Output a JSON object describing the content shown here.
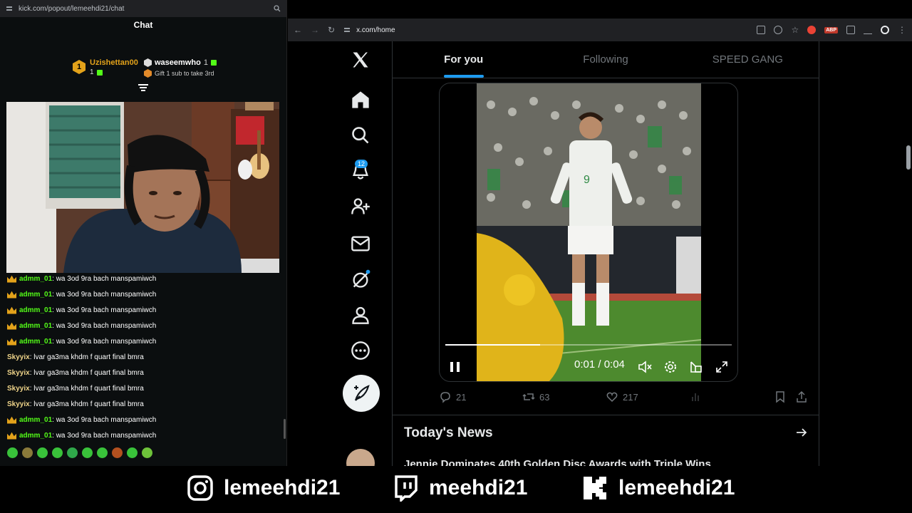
{
  "chat_window": {
    "url": "kick.com/popout/lemeehdi21/chat",
    "title": "Chat",
    "leaderboard": [
      {
        "rank": "1",
        "name": "Uzishettan00",
        "count": "1"
      },
      {
        "name": "waseemwho",
        "count": "1",
        "note": "Gift 1 sub to take 3rd"
      }
    ],
    "messages": [
      {
        "user": "admm_01",
        "text": ": wa 3od 9ra bach manspamiwch",
        "badge": "crown"
      },
      {
        "user": "admm_01",
        "text": ": wa 3od 9ra bach manspamiwch",
        "badge": "crown"
      },
      {
        "user": "admm_01",
        "text": ": wa 3od 9ra bach manspamiwch",
        "badge": "crown"
      },
      {
        "user": "admm_01",
        "text": ": wa 3od 9ra bach manspamiwch",
        "badge": "crown"
      },
      {
        "user": "admm_01",
        "text": ": wa 3od 9ra bach manspamiwch",
        "badge": "crown"
      },
      {
        "user": "Skyyix",
        "text": ": lvar ga3ma khdm f quart final bmra",
        "badge": ""
      },
      {
        "user": "Skyyix",
        "text": ": lvar ga3ma khdm f quart final bmra",
        "badge": ""
      },
      {
        "user": "Skyyix",
        "text": ": lvar ga3ma khdm f quart final bmra",
        "badge": ""
      },
      {
        "user": "Skyyix",
        "text": ": lvar ga3ma khdm f quart final bmra",
        "badge": ""
      },
      {
        "user": "admm_01",
        "text": ": wa 3od 9ra bach manspamiwch",
        "badge": "crown"
      },
      {
        "user": "admm_01",
        "text": ": wa 3od 9ra bach manspamiwch",
        "badge": "crown"
      }
    ],
    "colors": {
      "kick_green": "#53fc18",
      "gold": "#e3a21a"
    }
  },
  "browser": {
    "url": "x.com/home",
    "notifications_count": "12",
    "tabs": [
      "For you",
      "Following",
      "SPEED GANG"
    ],
    "active_tab": "For you",
    "video": {
      "time": "0:01 / 0:04",
      "progress": 0.33
    },
    "post_actions": {
      "replies": "21",
      "reposts": "63",
      "likes": "217"
    },
    "news": {
      "title": "Today's News",
      "headline": "Jennie Dominates 40th Golden Disc Awards with Triple Wins"
    },
    "colors": {
      "accent": "#1d9bf0"
    }
  },
  "socials": [
    {
      "platform": "instagram-icon",
      "handle": "lemeehdi21"
    },
    {
      "platform": "twitch-icon",
      "handle": "meehdi21"
    },
    {
      "platform": "kick-icon",
      "handle": "lemeehdi21"
    }
  ]
}
